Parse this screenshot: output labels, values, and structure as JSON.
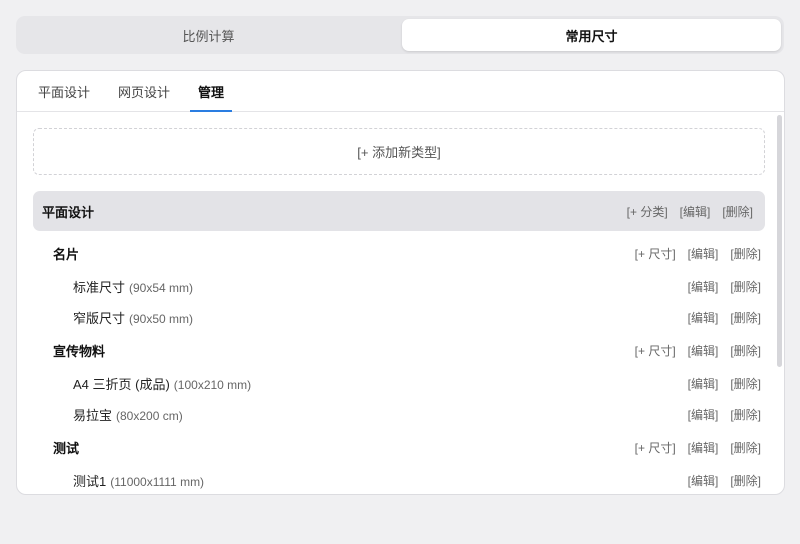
{
  "segment": {
    "left": "比例计算",
    "right": "常用尺寸"
  },
  "tabs": [
    "平面设计",
    "网页设计",
    "管理"
  ],
  "add_type_label": "[+ 添加新类型]",
  "group": {
    "title": "平面设计",
    "add_label": "[+ 分类]",
    "edit_label": "[编辑]",
    "delete_label": "[删除]"
  },
  "categories": [
    {
      "title": "名片",
      "add_label": "[+ 尺寸]",
      "edit_label": "[编辑]",
      "delete_label": "[删除]",
      "items": [
        {
          "name": "标准尺寸",
          "dim": "(90x54 mm)",
          "edit_label": "[编辑]",
          "delete_label": "[删除]"
        },
        {
          "name": "窄版尺寸",
          "dim": "(90x50 mm)",
          "edit_label": "[编辑]",
          "delete_label": "[删除]"
        }
      ]
    },
    {
      "title": "宣传物料",
      "add_label": "[+ 尺寸]",
      "edit_label": "[编辑]",
      "delete_label": "[删除]",
      "items": [
        {
          "name": "A4 三折页 (成品)",
          "dim": "(100x210 mm)",
          "edit_label": "[编辑]",
          "delete_label": "[删除]"
        },
        {
          "name": "易拉宝",
          "dim": "(80x200 cm)",
          "edit_label": "[编辑]",
          "delete_label": "[删除]"
        }
      ]
    },
    {
      "title": "测试",
      "add_label": "[+ 尺寸]",
      "edit_label": "[编辑]",
      "delete_label": "[删除]",
      "items": [
        {
          "name": "测试1",
          "dim": "(11000x1111 mm)",
          "edit_label": "[编辑]",
          "delete_label": "[删除]"
        }
      ]
    }
  ],
  "colors": {
    "accent": "#2a7de1",
    "background": "#f0f0f2",
    "card": "#ffffff",
    "group_header": "#e3e3e7"
  }
}
